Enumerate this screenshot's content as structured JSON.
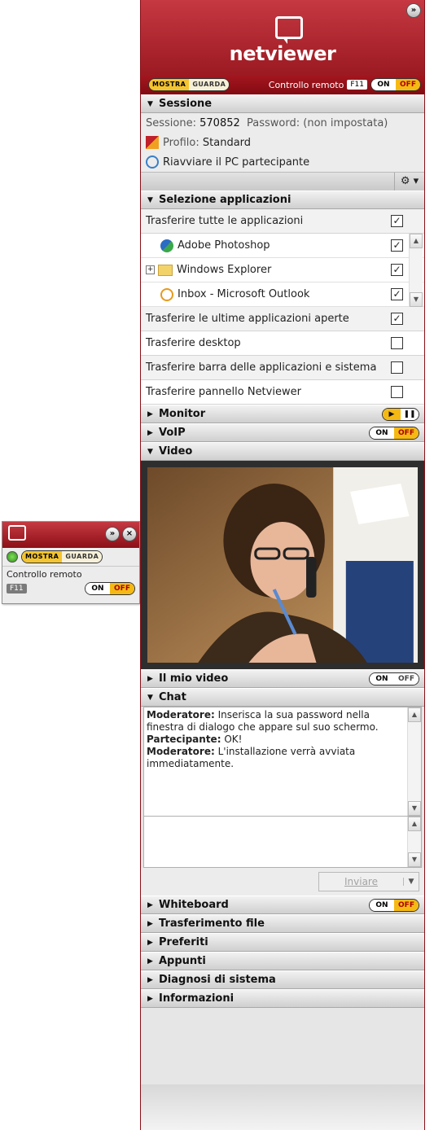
{
  "mini_panel": {
    "mostra_label": "MOSTRA",
    "guarda_label": "GUARDA",
    "remote_label": "Controllo remoto",
    "f11_label": "F11",
    "on_label": "ON",
    "off_label": "OFF"
  },
  "header": {
    "logo_text": "netviewer",
    "mostra_label": "MOSTRA",
    "guarda_label": "GUARDA",
    "remote_label": "Controllo remoto",
    "f11_label": "F11",
    "on_label": "ON",
    "off_label": "OFF"
  },
  "sessione": {
    "title": "Sessione",
    "session_label": "Sessione:",
    "session_value": "570852",
    "password_label": "Password:",
    "password_value": "(non impostata)",
    "profile_label": "Profilo:",
    "profile_value": "Standard",
    "restart_label": "Riavviare il PC partecipante"
  },
  "selezione": {
    "title": "Selezione applicazioni",
    "all_apps": "Trasferire tutte le applicazioni",
    "apps": [
      {
        "name": "Adobe Photoshop",
        "checked": true
      },
      {
        "name": "Windows Explorer",
        "checked": true
      },
      {
        "name": "Inbox - Microsoft Outlook",
        "checked": true
      }
    ],
    "options": [
      {
        "label": "Trasferire le ultime applicazioni aperte",
        "checked": true
      },
      {
        "label": "Trasferire desktop",
        "checked": false
      },
      {
        "label": "Trasferire barra delle applicazioni e sistema",
        "checked": false
      },
      {
        "label": "Trasferire pannello Netviewer",
        "checked": false
      }
    ]
  },
  "sections": {
    "monitor": "Monitor",
    "voip": "VoIP",
    "video": "Video",
    "mio_video": "Il mio video",
    "chat": "Chat",
    "whiteboard": "Whiteboard",
    "trasferimento": "Trasferimento file",
    "preferiti": "Preferiti",
    "appunti": "Appunti",
    "diagnosi": "Diagnosi di sistema",
    "informazioni": "Informazioni"
  },
  "toggles": {
    "on": "ON",
    "off": "OFF"
  },
  "chat": {
    "messages": [
      {
        "who": "Moderatore:",
        "text": " Inserisca la sua password nella finestra di dialogo che appare sul suo schermo."
      },
      {
        "who": "Partecipante:",
        "text": " OK!"
      },
      {
        "who": "Moderatore:",
        "text": " L'installazione verrà avviata immediatamente."
      }
    ],
    "send_label": "Inviare"
  },
  "icons": {
    "close": "double-chevron-icon",
    "gear": "gear-icon"
  }
}
